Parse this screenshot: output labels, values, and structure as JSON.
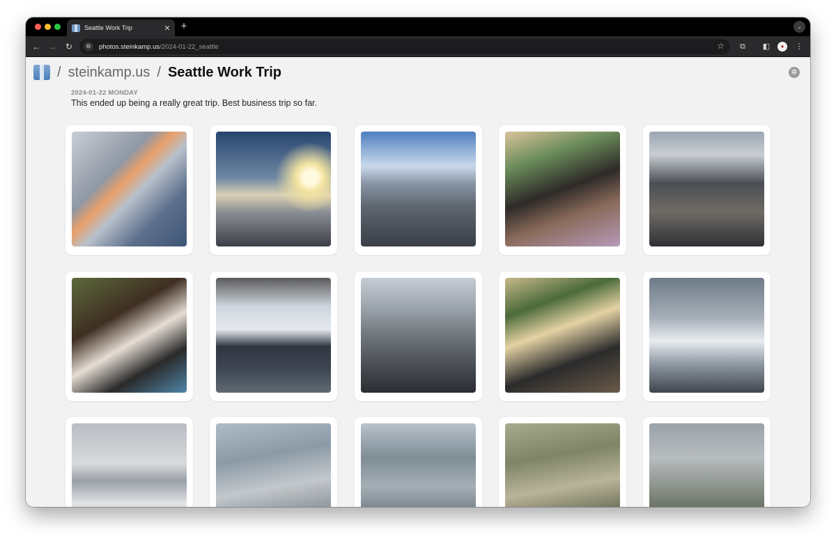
{
  "browser": {
    "tab": {
      "title": "Seattle Work Trip",
      "close": "✕"
    },
    "new_tab": "+",
    "url_host": "photos.steinkamp.us",
    "url_path": "/2024-01-22_seattle"
  },
  "page": {
    "breadcrumb": {
      "separator": "/",
      "site": "steinkamp.us",
      "title": "Seattle Work Trip"
    },
    "date": "2024-01-22 MONDAY",
    "description": "This ended up being a really great trip. Best business trip so far."
  },
  "photos": [
    {
      "subject": "airplane-wing-over-snowy-mountains"
    },
    {
      "subject": "airplane-wing-at-sunset"
    },
    {
      "subject": "seattle-skyline-from-above"
    },
    {
      "subject": "two-people-on-couch"
    },
    {
      "subject": "downtown-towers-view"
    },
    {
      "subject": "three-people-at-dinner"
    },
    {
      "subject": "group-at-observation-window"
    },
    {
      "subject": "aerial-downtown-seattle"
    },
    {
      "subject": "group-in-restaurant"
    },
    {
      "subject": "wing-above-clouds"
    },
    {
      "subject": "lenticular-clouds"
    },
    {
      "subject": "aerial-coastal-city"
    },
    {
      "subject": "aerial-bay-and-bridges"
    },
    {
      "subject": "aerial-green-hills"
    },
    {
      "subject": "aerial-hilltop-observatory"
    }
  ]
}
